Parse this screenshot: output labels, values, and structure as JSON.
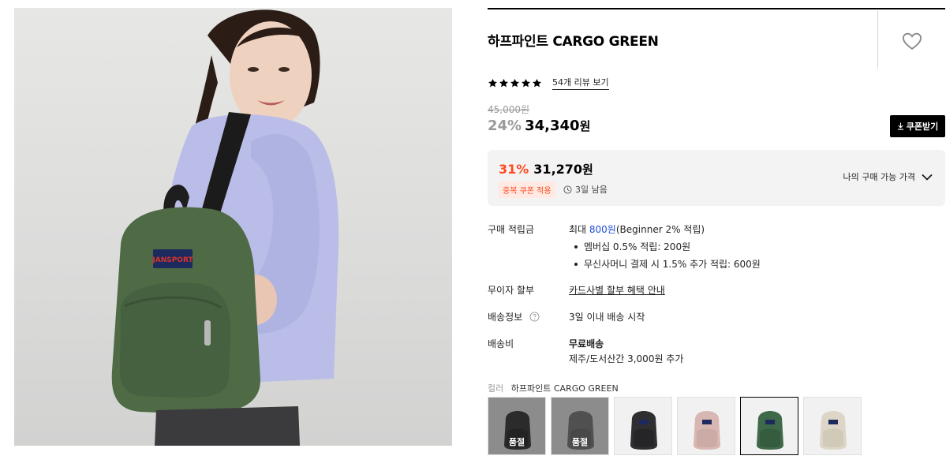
{
  "product": {
    "title": "하프파인트 CARGO GREEN",
    "rating_stars": 5,
    "review_link": "54개 리뷰 보기"
  },
  "pricing": {
    "original_price": "45,000원",
    "discount_percent": "24%",
    "sale_price": "34,340",
    "currency": "원",
    "coupon_button": "쿠폰받기"
  },
  "best_price": {
    "discount_percent": "31%",
    "price": "31,270",
    "currency": "원",
    "badge": "중복 쿠폰 적용",
    "time_left": "3일 남음",
    "my_price_label": "나의 구매 가능 가격"
  },
  "details": {
    "points_label": "구매 적립금",
    "points_prefix": "최대 ",
    "points_amount": "800원",
    "points_suffix": "(Beginner 2% 적립)",
    "points_bullets": [
      "멤버십 0.5% 적립: 200원",
      "무신사머니 결제 시 1.5% 추가 적립: 600원"
    ],
    "installment_label": "무이자 할부",
    "installment_link": "카드사별 할부 혜택 안내",
    "shipping_info_label": "배송정보",
    "shipping_info_value": "3일 이내 배송 시작",
    "shipping_fee_label": "배송비",
    "shipping_fee_value": "무료배송",
    "shipping_fee_note": "제주/도서산간 3,000원 추가"
  },
  "color": {
    "label": "컬러",
    "selected": "하프파인트 CARGO GREEN",
    "soldout_label": "품절",
    "swatches": [
      {
        "color": "#4a4a4a",
        "soldout": true
      },
      {
        "color": "#8a8a8a",
        "soldout": true
      },
      {
        "color": "#2f2f31",
        "soldout": false
      },
      {
        "color": "#d8b7b2",
        "soldout": false
      },
      {
        "color": "#3f6a4a",
        "soldout": false,
        "selected": true
      },
      {
        "color": "#ddd6c6",
        "soldout": false
      }
    ]
  },
  "icons": {
    "heart": "heart-icon",
    "star": "star-icon",
    "download": "download-icon",
    "clock": "clock-icon",
    "chevron": "chevron-down-icon",
    "help": "help-circle-icon"
  }
}
